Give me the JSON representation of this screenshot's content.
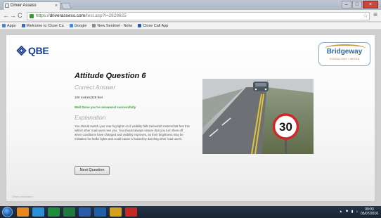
{
  "browser": {
    "tab_title": "Driver Assess",
    "url_secure": "https://",
    "url_host": "driverassess.com",
    "url_path": "/test.asp?l=2828625",
    "bookmarks": [
      {
        "label": "Apps",
        "icon": "apps-grid-icon",
        "color": "#4a7fd4"
      },
      {
        "label": "Welcome to Close Ca",
        "icon": "globe-icon",
        "color": "#3b6cb3"
      },
      {
        "label": "Google",
        "icon": "google-icon",
        "color": "#4285f4"
      },
      {
        "label": "New Sentinel - Netw",
        "icon": "page-icon",
        "color": "#8a8a8a"
      },
      {
        "label": "Close Call App",
        "icon": "app-icon",
        "color": "#2a5aa8"
      }
    ]
  },
  "page": {
    "insurer_logo": "QBE",
    "partner_logo": {
      "name": "Bridgeway",
      "tagline": "CONSULTING LIMITED"
    },
    "question_title": "Attitude Question 6",
    "correct_answer_heading": "Correct Answer",
    "correct_answer_text": "100 metres/328 feet",
    "result_message": "Well Done you've answered successfully",
    "explanation_heading": "Explanation",
    "explanation_text": "You should switch your rear fog lights on if visibility falls below100 metres/328 feet this will let other road users see you. You should always ensure that you turn them off when conditions have changed and visibility improves, as their brightness may be mistaken for brake lights and could cause a hazard by dazzling other road users.",
    "next_button": "Next Question",
    "footer": "Drivers Information",
    "photo": {
      "sign_speed": "30",
      "description_icon": "foggy-road-photo"
    }
  },
  "taskbar": {
    "time": "09:03",
    "date": "05/07/2016",
    "apps": [
      {
        "icon": "firefox-icon",
        "color": "#e8871e"
      },
      {
        "icon": "explorer-icon",
        "color": "#2b8fd8"
      },
      {
        "icon": "chrome-icon",
        "color": "#1e8c3a"
      },
      {
        "icon": "excel-icon",
        "color": "#1f7a3e"
      },
      {
        "icon": "word-icon",
        "color": "#2a5ba8"
      },
      {
        "icon": "outlook-icon",
        "color": "#1f5fa8"
      },
      {
        "icon": "folder-icon",
        "color": "#d4a11e"
      },
      {
        "icon": "pdf-icon",
        "color": "#c42a22"
      }
    ]
  },
  "colors": {
    "brand_blue": "#1a3e8c",
    "success_green": "#33a52a",
    "bridgeway_blue": "#2c6aa6"
  }
}
